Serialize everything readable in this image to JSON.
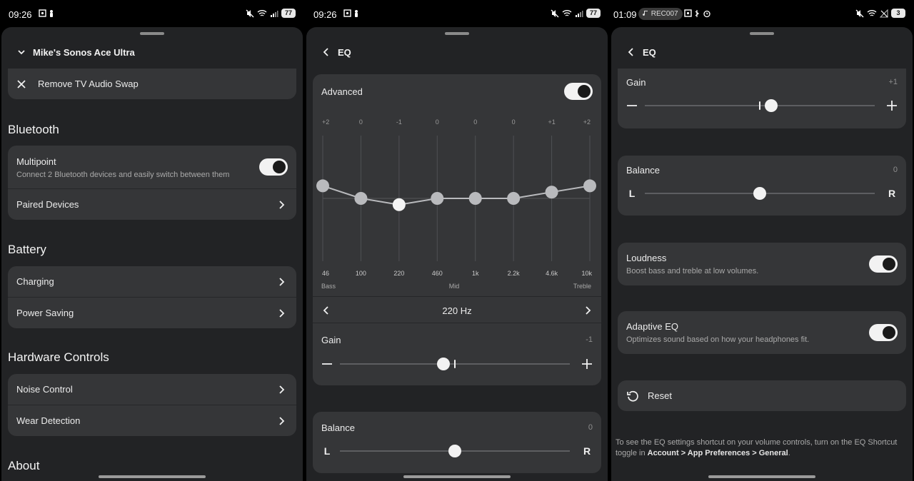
{
  "screen1": {
    "status": {
      "time": "09:26",
      "battery": "77"
    },
    "header": {
      "title": "Mike's Sonos Ace Ultra"
    },
    "remove_row": {
      "label": "Remove TV Audio Swap"
    },
    "bluetooth": {
      "title": "Bluetooth",
      "multipoint": {
        "label": "Multipoint",
        "sub": "Connect 2 Bluetooth devices and easily switch between them",
        "on": true
      },
      "paired": {
        "label": "Paired Devices"
      }
    },
    "battery": {
      "title": "Battery",
      "items": [
        {
          "label": "Charging"
        },
        {
          "label": "Power Saving"
        }
      ]
    },
    "hardware": {
      "title": "Hardware Controls",
      "items": [
        {
          "label": "Noise Control"
        },
        {
          "label": "Wear Detection"
        }
      ]
    },
    "about": {
      "title": "About"
    }
  },
  "screen2": {
    "status": {
      "time": "09:26",
      "battery": "77"
    },
    "header": {
      "title": "EQ"
    },
    "advanced": {
      "label": "Advanced",
      "on": true
    },
    "eq": {
      "gains": [
        "+2",
        "0",
        "-1",
        "0",
        "0",
        "0",
        "+1",
        "+2"
      ],
      "gain_values": [
        2,
        0,
        -1,
        0,
        0,
        0,
        1,
        2
      ],
      "gain_range": [
        -10,
        10
      ],
      "freqs": [
        "46",
        "100",
        "220",
        "460",
        "1k",
        "2.2k",
        "4.6k",
        "10k"
      ],
      "selected_index": 2,
      "region_labels": {
        "bass": "Bass",
        "mid": "Mid",
        "treble": "Treble"
      }
    },
    "band_selector": {
      "label": "220 Hz"
    },
    "gain": {
      "label": "Gain",
      "value": "-1",
      "position": 0.45
    },
    "balance": {
      "label": "Balance",
      "value": "0",
      "left": "L",
      "right": "R",
      "position": 0.5
    }
  },
  "screen3": {
    "status": {
      "time": "01:09",
      "rec": "REC007",
      "battery": "3"
    },
    "header": {
      "title": "EQ"
    },
    "gain": {
      "label": "Gain",
      "value": "+1",
      "position": 0.55
    },
    "balance": {
      "label": "Balance",
      "value": "0",
      "left": "L",
      "right": "R",
      "position": 0.5
    },
    "loudness": {
      "label": "Loudness",
      "sub": "Boost bass and treble at low volumes.",
      "on": true
    },
    "adaptive": {
      "label": "Adaptive EQ",
      "sub": "Optimizes sound based on how your headphones fit.",
      "on": true
    },
    "reset": {
      "label": "Reset"
    },
    "footnote": {
      "text": "To see the EQ settings shortcut on your volume controls, turn on the EQ Shortcut toggle in ",
      "path": "Account > App Preferences > General",
      "end": "."
    }
  }
}
